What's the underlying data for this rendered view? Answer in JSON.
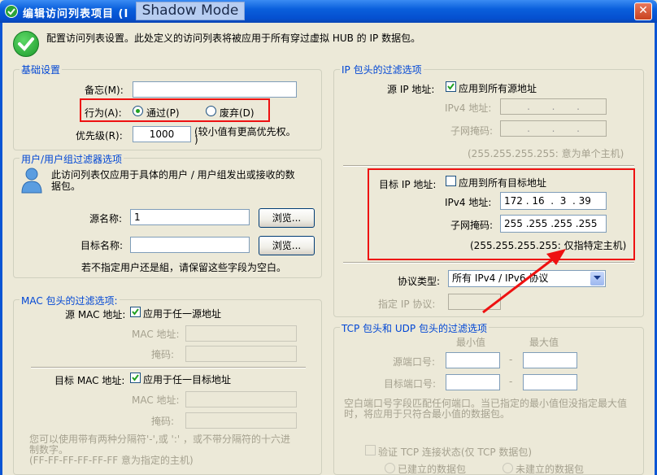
{
  "window": {
    "title": "编辑访问列表项目 (I",
    "overlay": "Shadow Mode",
    "close": "✕"
  },
  "intro": "配置访问列表设置。此处定义的访问列表将被应用于所有穿过虚拟 HUB 的 IP 数据包。",
  "basic": {
    "title": "基础设置",
    "memo_label": "备忘(M):",
    "memo_value": "",
    "action_label": "行为(A):",
    "pass_label": "通过(P)",
    "discard_label": "废弃(D)",
    "action_selected": "pass",
    "priority_label": "优先级(R):",
    "priority_value": "1000",
    "priority_hint_1": "(较小值有更高优先权。",
    "priority_hint_2": ")"
  },
  "user": {
    "title": "用户/用户组过滤器选项",
    "desc_1": "此访问列表仅应用于具体的用户 / 用户组发出或接收的数",
    "desc_2": "据包。",
    "src_label": "源名称:",
    "src_value": "1",
    "dst_label": "目标名称:",
    "dst_value": "",
    "browse_label": "浏览...",
    "note": "若不指定用户还是組，请保留这些字段为空白。"
  },
  "mac": {
    "title": "MAC 包头的过滤选项:",
    "src_label": "源 MAC 地址:",
    "src_any": "应用于任一源地址",
    "mac_addr_label": "MAC 地址:",
    "mask_label": "掩码:",
    "dst_label": "目标 MAC 地址:",
    "dst_any": "应用于任一目标地址",
    "hint_1": "您可以使用带有两种分隔符'-',或 ':' ，或不带分隔符的十六进",
    "hint_2": "制数字。",
    "hint_3": "(FF-FF-FF-FF-FF-FF 意为指定的主机)"
  },
  "ip": {
    "title": "IP 包头的过滤选项",
    "src_label": "源 IP 地址:",
    "src_all": "应用到所有源地址",
    "src_all_checked": true,
    "ipv4_label": "IPv4 地址:",
    "subnet_label": "子网掩码:",
    "src_hint": "(255.255.255.255: 意为单个主机)",
    "dst_label": "目标 IP 地址:",
    "dst_all": "应用到所有目标地址",
    "dst_all_checked": false,
    "dst_ipv4": "172 . 16  .  3  . 39",
    "dst_mask": "255 .255 .255 .255",
    "dst_hint": "(255.255.255.255: 仅指特定主机)",
    "protocol_label": "协议类型:",
    "protocol_value": "所有 IPv4 / IPv6 协议",
    "spec_protocol_label": "指定 IP 协议:"
  },
  "tcp": {
    "title": "TCP 包头和 UDP 包头的过滤选项",
    "min_label": "最小值",
    "max_label": "最大值",
    "src_port_label": "源端口号:",
    "dst_port_label": "目标端口号:",
    "dash": "-",
    "hint_1": "空白端口号字段匹配任何端口。当已指定的最小值但没指定最大值",
    "hint_2": "时，将应用于只符合最小值的数据包。",
    "verify_label": "验证 TCP 连接状态(仅 TCP 数据包)",
    "established_label": "已建立的数据包",
    "not_established_label": "未建立的数据包"
  },
  "colors": {
    "title_blue": "#0a5fdc",
    "group_title": "#0046d5",
    "highlight_red": "#e11111",
    "check_green": "#21a121"
  }
}
